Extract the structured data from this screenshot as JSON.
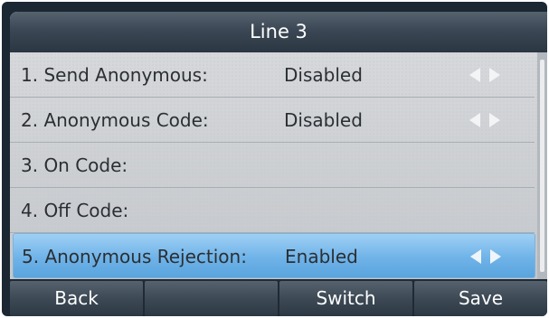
{
  "title": "Line 3",
  "rows": [
    {
      "label": "1. Send Anonymous:",
      "value": "Disabled",
      "has_arrows": true,
      "selected": false
    },
    {
      "label": "2. Anonymous Code:",
      "value": "Disabled",
      "has_arrows": true,
      "selected": false
    },
    {
      "label": "3. On Code:",
      "value": "",
      "has_arrows": false,
      "selected": false
    },
    {
      "label": "4. Off Code:",
      "value": "",
      "has_arrows": false,
      "selected": false
    },
    {
      "label": "5. Anonymous Rejection:",
      "value": "Enabled",
      "has_arrows": true,
      "selected": true
    }
  ],
  "softkeys": [
    "Back",
    "",
    "Switch",
    "Save"
  ],
  "colors": {
    "title_bar": "#3b4754",
    "selected_row": "#6fb3e8",
    "softkey": "#3d4955"
  }
}
